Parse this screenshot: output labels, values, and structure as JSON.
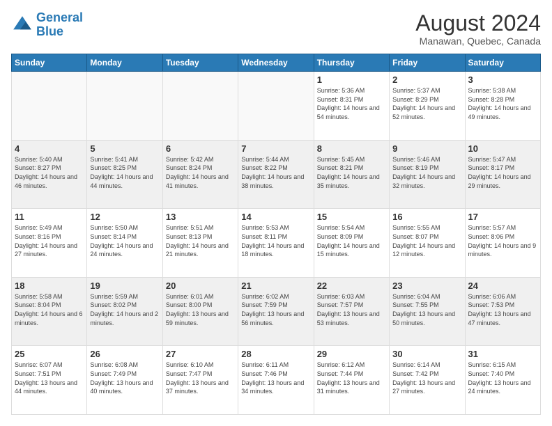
{
  "header": {
    "logo_line1": "General",
    "logo_line2": "Blue",
    "main_title": "August 2024",
    "subtitle": "Manawan, Quebec, Canada"
  },
  "days_of_week": [
    "Sunday",
    "Monday",
    "Tuesday",
    "Wednesday",
    "Thursday",
    "Friday",
    "Saturday"
  ],
  "weeks": [
    [
      {
        "date": "",
        "info": ""
      },
      {
        "date": "",
        "info": ""
      },
      {
        "date": "",
        "info": ""
      },
      {
        "date": "",
        "info": ""
      },
      {
        "date": "1",
        "info": "Sunrise: 5:36 AM\nSunset: 8:31 PM\nDaylight: 14 hours\nand 54 minutes."
      },
      {
        "date": "2",
        "info": "Sunrise: 5:37 AM\nSunset: 8:29 PM\nDaylight: 14 hours\nand 52 minutes."
      },
      {
        "date": "3",
        "info": "Sunrise: 5:38 AM\nSunset: 8:28 PM\nDaylight: 14 hours\nand 49 minutes."
      }
    ],
    [
      {
        "date": "4",
        "info": "Sunrise: 5:40 AM\nSunset: 8:27 PM\nDaylight: 14 hours\nand 46 minutes."
      },
      {
        "date": "5",
        "info": "Sunrise: 5:41 AM\nSunset: 8:25 PM\nDaylight: 14 hours\nand 44 minutes."
      },
      {
        "date": "6",
        "info": "Sunrise: 5:42 AM\nSunset: 8:24 PM\nDaylight: 14 hours\nand 41 minutes."
      },
      {
        "date": "7",
        "info": "Sunrise: 5:44 AM\nSunset: 8:22 PM\nDaylight: 14 hours\nand 38 minutes."
      },
      {
        "date": "8",
        "info": "Sunrise: 5:45 AM\nSunset: 8:21 PM\nDaylight: 14 hours\nand 35 minutes."
      },
      {
        "date": "9",
        "info": "Sunrise: 5:46 AM\nSunset: 8:19 PM\nDaylight: 14 hours\nand 32 minutes."
      },
      {
        "date": "10",
        "info": "Sunrise: 5:47 AM\nSunset: 8:17 PM\nDaylight: 14 hours\nand 29 minutes."
      }
    ],
    [
      {
        "date": "11",
        "info": "Sunrise: 5:49 AM\nSunset: 8:16 PM\nDaylight: 14 hours\nand 27 minutes."
      },
      {
        "date": "12",
        "info": "Sunrise: 5:50 AM\nSunset: 8:14 PM\nDaylight: 14 hours\nand 24 minutes."
      },
      {
        "date": "13",
        "info": "Sunrise: 5:51 AM\nSunset: 8:13 PM\nDaylight: 14 hours\nand 21 minutes."
      },
      {
        "date": "14",
        "info": "Sunrise: 5:53 AM\nSunset: 8:11 PM\nDaylight: 14 hours\nand 18 minutes."
      },
      {
        "date": "15",
        "info": "Sunrise: 5:54 AM\nSunset: 8:09 PM\nDaylight: 14 hours\nand 15 minutes."
      },
      {
        "date": "16",
        "info": "Sunrise: 5:55 AM\nSunset: 8:07 PM\nDaylight: 14 hours\nand 12 minutes."
      },
      {
        "date": "17",
        "info": "Sunrise: 5:57 AM\nSunset: 8:06 PM\nDaylight: 14 hours\nand 9 minutes."
      }
    ],
    [
      {
        "date": "18",
        "info": "Sunrise: 5:58 AM\nSunset: 8:04 PM\nDaylight: 14 hours\nand 6 minutes."
      },
      {
        "date": "19",
        "info": "Sunrise: 5:59 AM\nSunset: 8:02 PM\nDaylight: 14 hours\nand 2 minutes."
      },
      {
        "date": "20",
        "info": "Sunrise: 6:01 AM\nSunset: 8:00 PM\nDaylight: 13 hours\nand 59 minutes."
      },
      {
        "date": "21",
        "info": "Sunrise: 6:02 AM\nSunset: 7:59 PM\nDaylight: 13 hours\nand 56 minutes."
      },
      {
        "date": "22",
        "info": "Sunrise: 6:03 AM\nSunset: 7:57 PM\nDaylight: 13 hours\nand 53 minutes."
      },
      {
        "date": "23",
        "info": "Sunrise: 6:04 AM\nSunset: 7:55 PM\nDaylight: 13 hours\nand 50 minutes."
      },
      {
        "date": "24",
        "info": "Sunrise: 6:06 AM\nSunset: 7:53 PM\nDaylight: 13 hours\nand 47 minutes."
      }
    ],
    [
      {
        "date": "25",
        "info": "Sunrise: 6:07 AM\nSunset: 7:51 PM\nDaylight: 13 hours\nand 44 minutes."
      },
      {
        "date": "26",
        "info": "Sunrise: 6:08 AM\nSunset: 7:49 PM\nDaylight: 13 hours\nand 40 minutes."
      },
      {
        "date": "27",
        "info": "Sunrise: 6:10 AM\nSunset: 7:47 PM\nDaylight: 13 hours\nand 37 minutes."
      },
      {
        "date": "28",
        "info": "Sunrise: 6:11 AM\nSunset: 7:46 PM\nDaylight: 13 hours\nand 34 minutes."
      },
      {
        "date": "29",
        "info": "Sunrise: 6:12 AM\nSunset: 7:44 PM\nDaylight: 13 hours\nand 31 minutes."
      },
      {
        "date": "30",
        "info": "Sunrise: 6:14 AM\nSunset: 7:42 PM\nDaylight: 13 hours\nand 27 minutes."
      },
      {
        "date": "31",
        "info": "Sunrise: 6:15 AM\nSunset: 7:40 PM\nDaylight: 13 hours\nand 24 minutes."
      }
    ]
  ]
}
